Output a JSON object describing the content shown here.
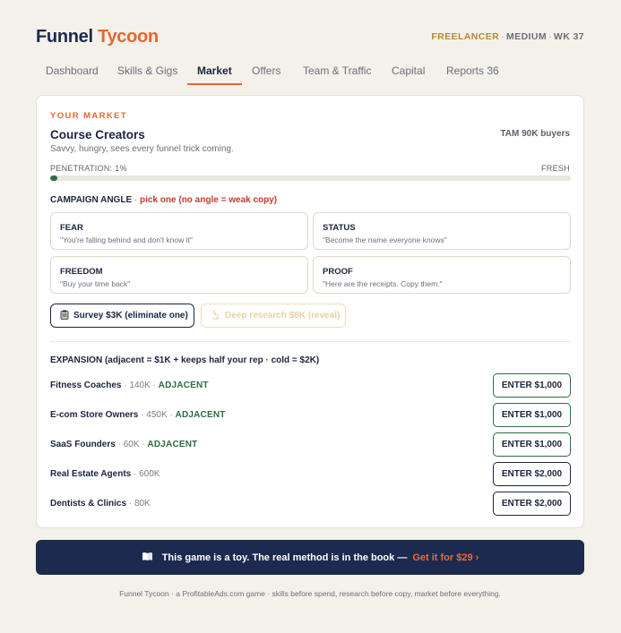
{
  "header": {
    "logo_part1": "Funnel",
    "logo_part2": "Tycoon",
    "role": "FREELANCER",
    "difficulty": "MEDIUM",
    "week": "WK 37",
    "separator": "·"
  },
  "tabs": [
    {
      "label": "Dashboard",
      "active": false
    },
    {
      "label": "Skills & Gigs",
      "active": false
    },
    {
      "label": "Market",
      "active": true
    },
    {
      "label": "Offers",
      "active": false
    },
    {
      "label": "Team & Traffic",
      "active": false
    },
    {
      "label": "Capital",
      "active": false
    },
    {
      "label": "Reports 36",
      "active": false
    }
  ],
  "market": {
    "kicker": "YOUR MARKET",
    "name": "Course Creators",
    "description": "Savvy, hungry, sees every funnel trick coming.",
    "tam": "TAM 90K buyers",
    "penetration_label": "PENETRATION: 1%",
    "penetration_fraction": 0.013,
    "freshness": "FRESH"
  },
  "campaign": {
    "title": "CAMPAIGN ANGLE",
    "separator": "·",
    "hint": "pick one (no angle = weak copy)",
    "angles": [
      {
        "title": "FEAR",
        "quote": "\"You're falling behind and don't know it\""
      },
      {
        "title": "STATUS",
        "quote": "\"Become the name everyone knows\""
      },
      {
        "title": "FREEDOM",
        "quote": "\"Buy your time back\""
      },
      {
        "title": "PROOF",
        "quote": "\"Here are the receipts. Copy them.\""
      }
    ],
    "survey_label": "Survey $3K (eliminate one)",
    "research_label": "Deep research $8K (reveal)",
    "survey_icon": "clipboard-icon",
    "research_icon": "microscope-icon"
  },
  "expansion": {
    "title": "EXPANSION (adjacent = $1K + keeps half your rep · cold = $2K)",
    "separator": "·",
    "markets": [
      {
        "name": "Fitness Coaches",
        "size": "140K",
        "tag": "ADJACENT",
        "button": "ENTER $1,000"
      },
      {
        "name": "E-com Store Owners",
        "size": "450K",
        "tag": "ADJACENT",
        "button": "ENTER $1,000"
      },
      {
        "name": "SaaS Founders",
        "size": "60K",
        "tag": "ADJACENT",
        "button": "ENTER $1,000"
      },
      {
        "name": "Real Estate Agents",
        "size": "600K",
        "tag": "",
        "button": "ENTER $2,000"
      },
      {
        "name": "Dentists & Clinics",
        "size": "80K",
        "tag": "",
        "button": "ENTER $2,000"
      }
    ]
  },
  "banner": {
    "icon": "book-icon",
    "text": "This game is a toy. The real method is in the book —",
    "cta": "Get it for $29 ›"
  },
  "footer": {
    "text": "Funnel Tycoon · a ProfitableAds.com game · skills before spend, research before copy, market before everything."
  }
}
